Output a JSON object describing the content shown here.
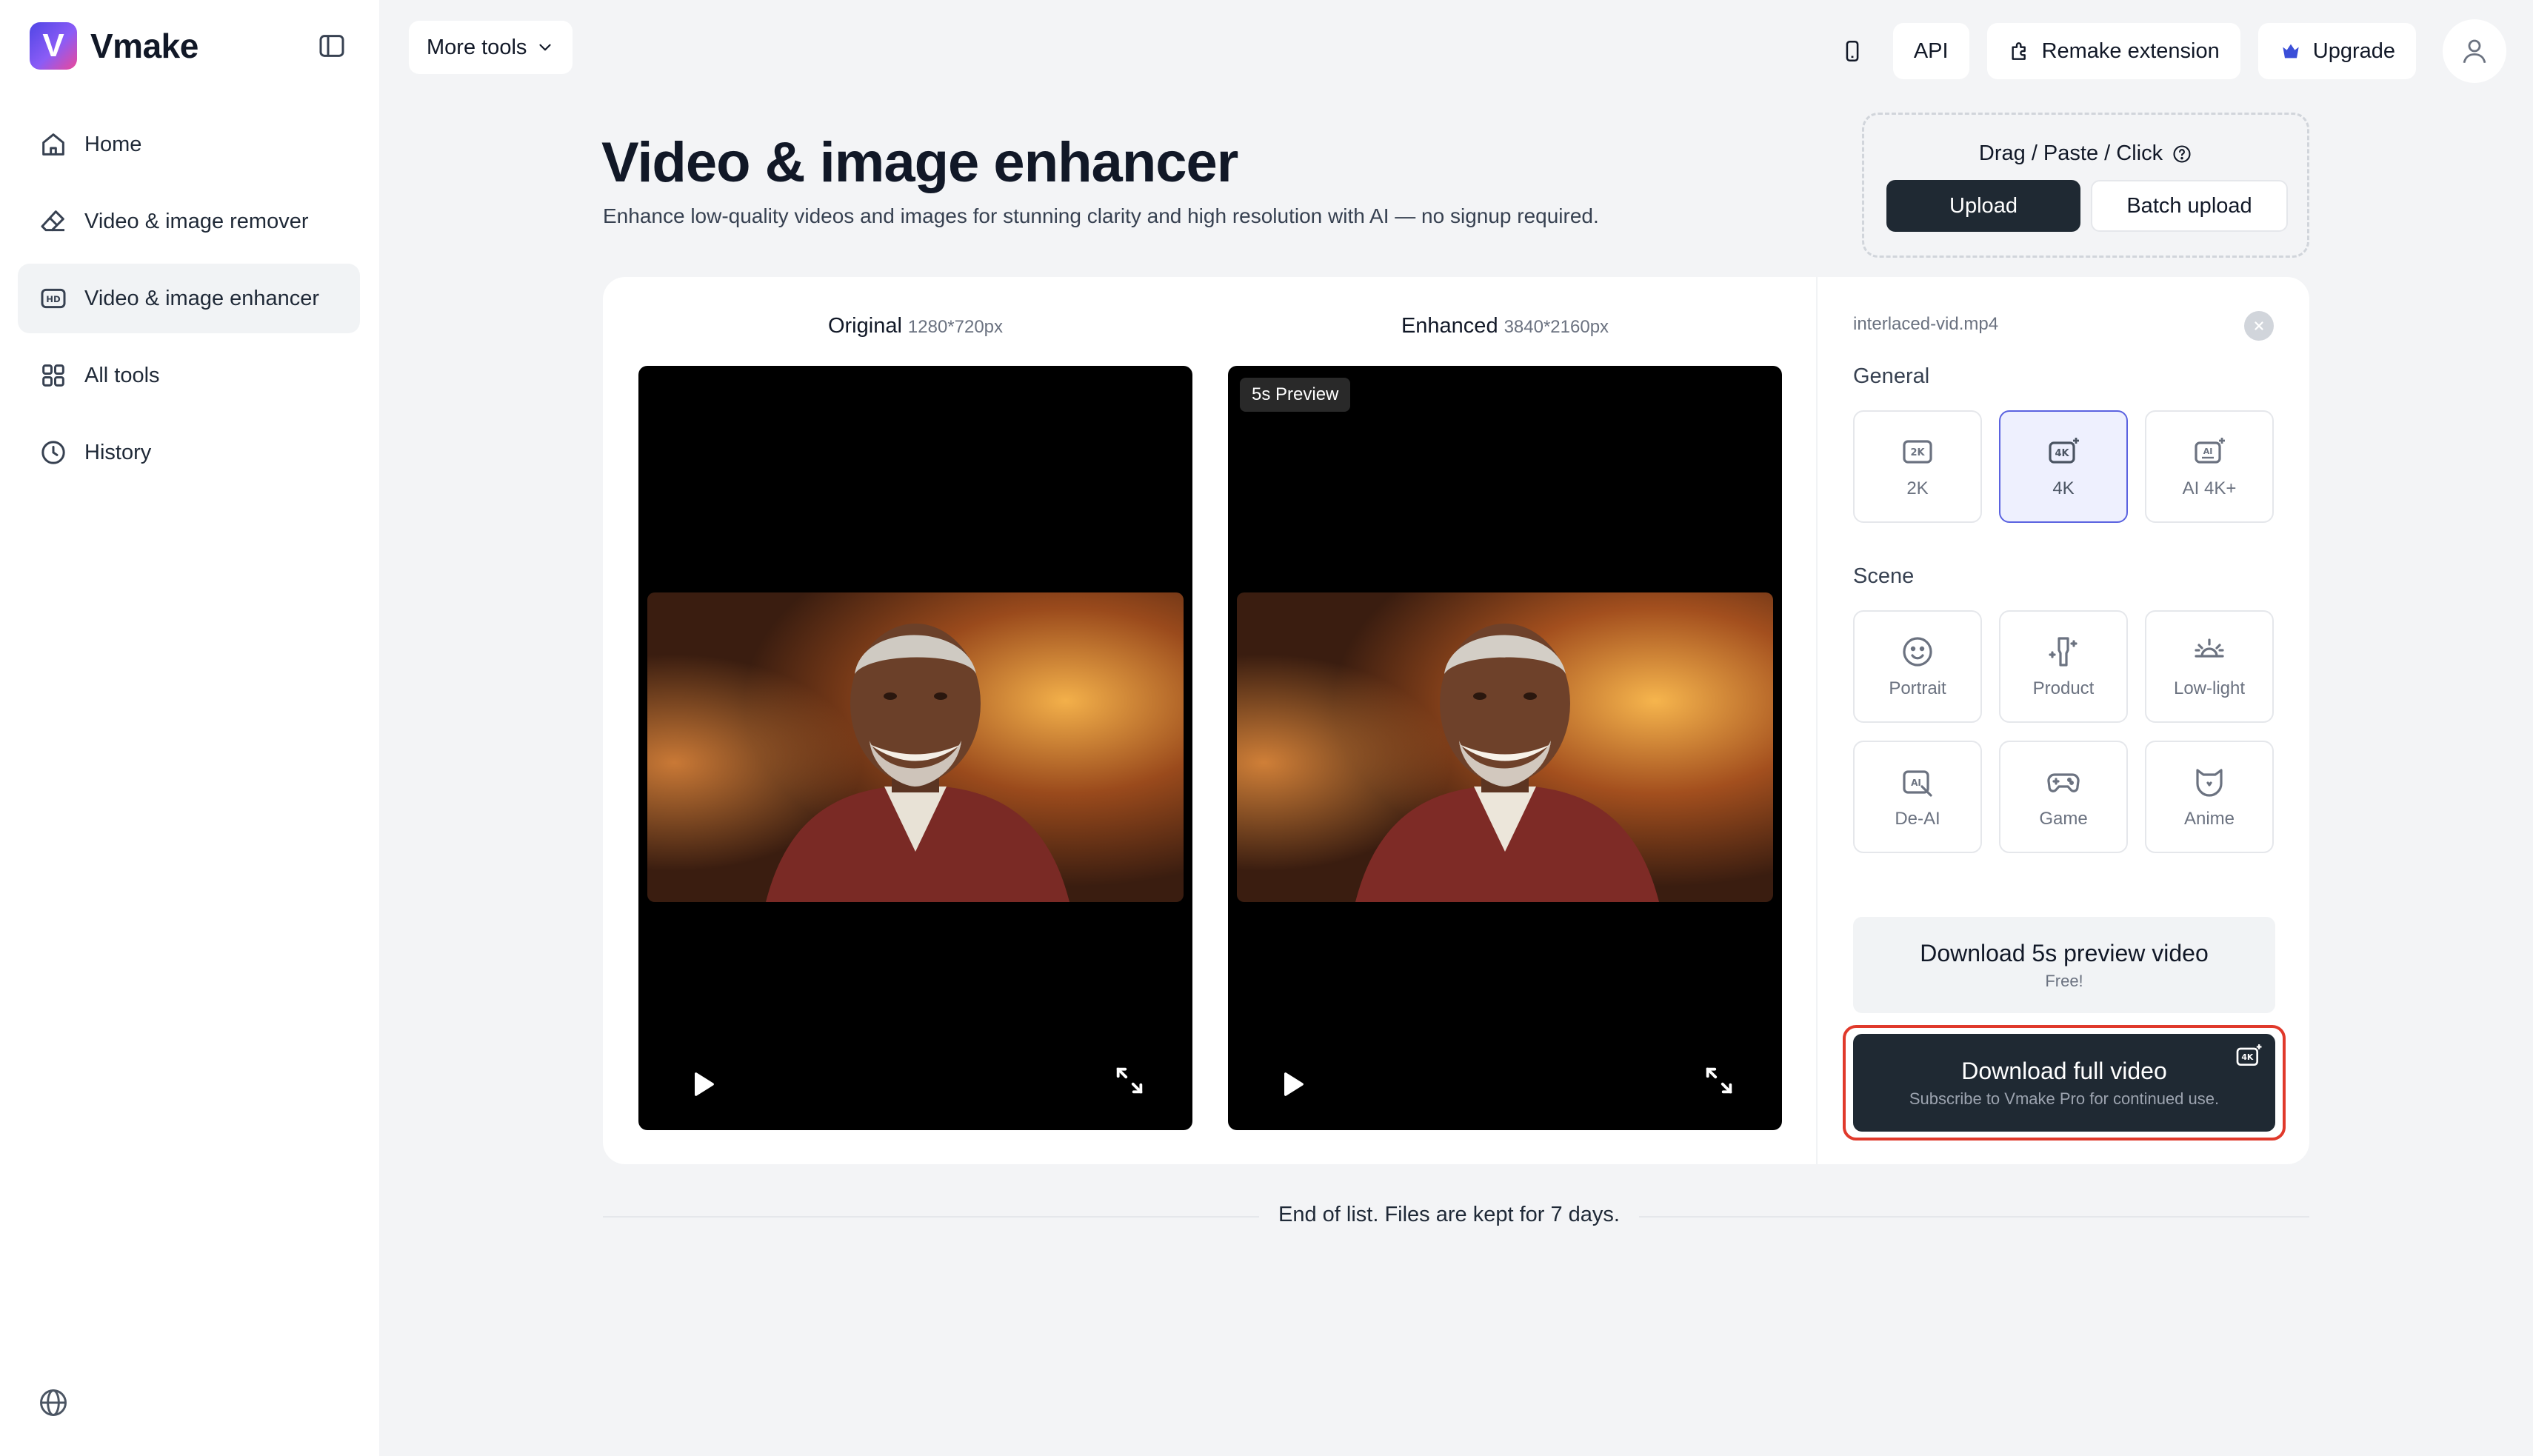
{
  "app": {
    "name": "Vmake"
  },
  "sidebar": {
    "items": [
      {
        "label": "Home",
        "icon": "home-icon",
        "active": false
      },
      {
        "label": "Video & image remover",
        "icon": "eraser-icon",
        "active": false
      },
      {
        "label": "Video & image enhancer",
        "icon": "hd-icon",
        "active": true
      },
      {
        "label": "All tools",
        "icon": "grid-icon",
        "active": false
      },
      {
        "label": "History",
        "icon": "clock-icon",
        "active": false
      }
    ]
  },
  "topbar": {
    "more_tools": "More tools",
    "api": "API",
    "remake_extension": "Remake extension",
    "upgrade": "Upgrade"
  },
  "header": {
    "title": "Video & image enhancer",
    "subtitle": "Enhance low-quality videos and images for stunning clarity and high resolution with AI — no signup required."
  },
  "upload": {
    "drag_label": "Drag / Paste / Click",
    "upload_button": "Upload",
    "batch_button": "Batch upload"
  },
  "compare": {
    "original_label": "Original",
    "original_dims": "1280*720px",
    "enhanced_label": "Enhanced",
    "enhanced_dims": "3840*2160px",
    "preview_badge": "5s Preview"
  },
  "settings": {
    "filename": "interlaced-vid.mp4",
    "general_label": "General",
    "general_options": [
      {
        "label": "2K",
        "icon": "2k-icon",
        "selected": false
      },
      {
        "label": "4K",
        "icon": "4k-icon",
        "selected": true
      },
      {
        "label": "AI 4K+",
        "icon": "ai-ultra-icon",
        "selected": false
      }
    ],
    "scene_label": "Scene",
    "scene_options": [
      {
        "label": "Portrait",
        "icon": "smile-icon"
      },
      {
        "label": "Product",
        "icon": "product-icon"
      },
      {
        "label": "Low-light",
        "icon": "sunrise-icon"
      },
      {
        "label": "De-AI",
        "icon": "de-ai-icon"
      },
      {
        "label": "Game",
        "icon": "gamepad-icon"
      },
      {
        "label": "Anime",
        "icon": "anime-icon"
      }
    ],
    "download_preview": {
      "title": "Download 5s preview video",
      "subtitle": "Free!"
    },
    "download_full": {
      "title": "Download full video",
      "subtitle": "Subscribe to Vmake Pro for continued use."
    }
  },
  "footer": {
    "text": "End of list. Files are kept for 7 days."
  },
  "colors": {
    "accent": "#5b63e0",
    "dark_button": "#1f2933",
    "highlight_outline": "#e0392b"
  }
}
